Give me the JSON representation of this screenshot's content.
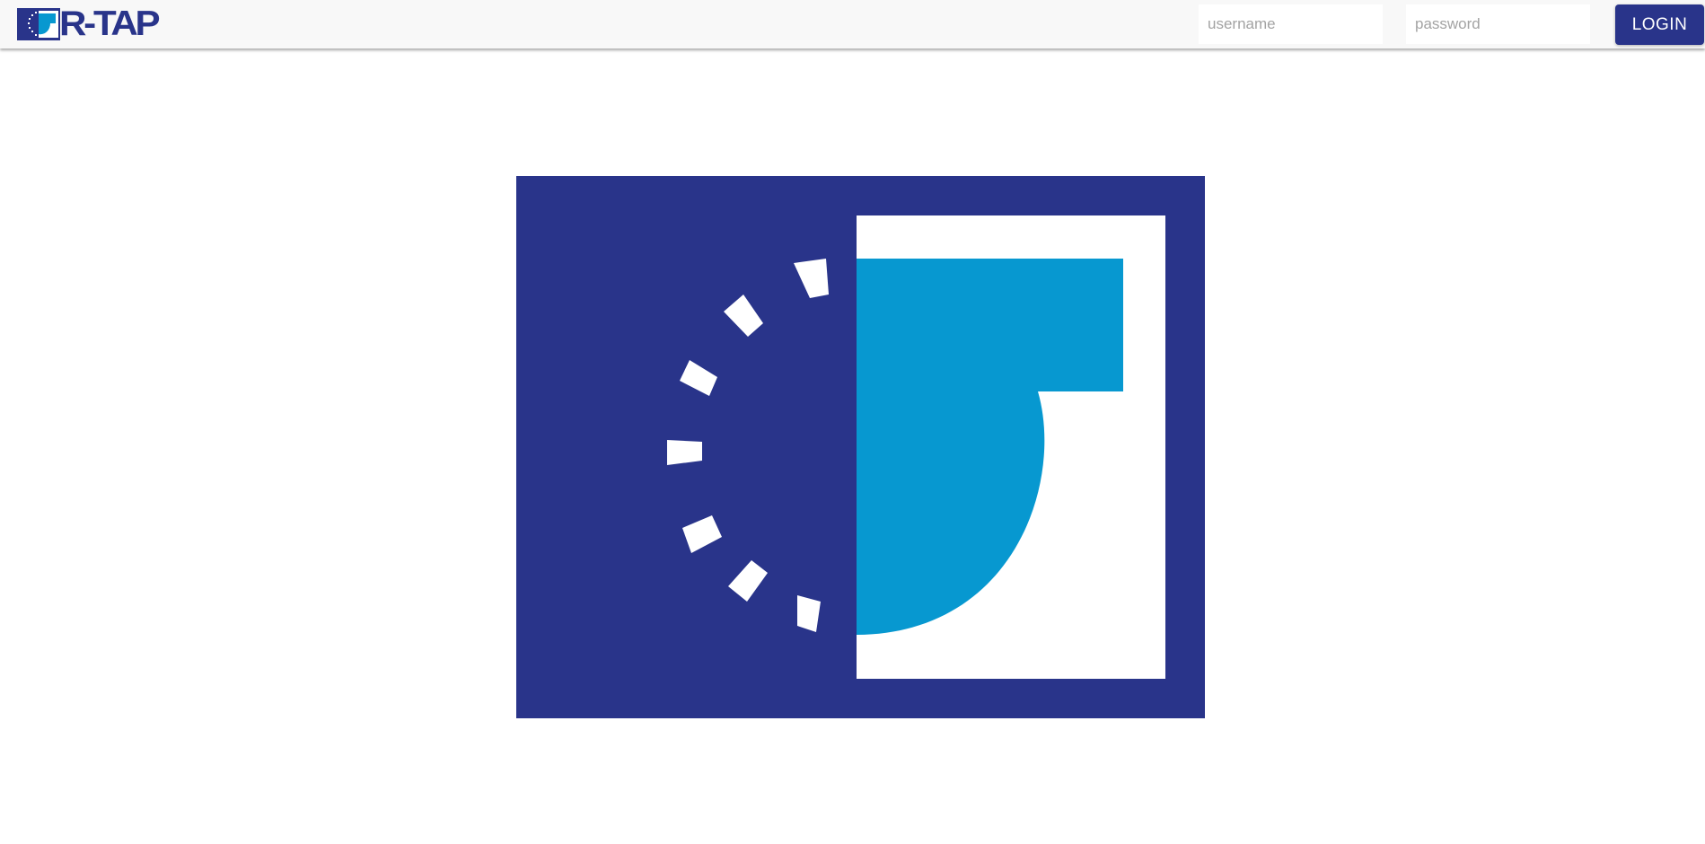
{
  "header": {
    "brand_text": "R-TAP",
    "username_placeholder": "username",
    "password_placeholder": "password",
    "login_label": "LOGIN"
  },
  "colors": {
    "brand_navy": "#29348a",
    "brand_cyan": "#0798d0",
    "topbar_bg": "#f8f8f8"
  },
  "icons": {
    "brand_mark": "r-tap-logo-icon",
    "hero": "r-tap-emblem-logo"
  }
}
